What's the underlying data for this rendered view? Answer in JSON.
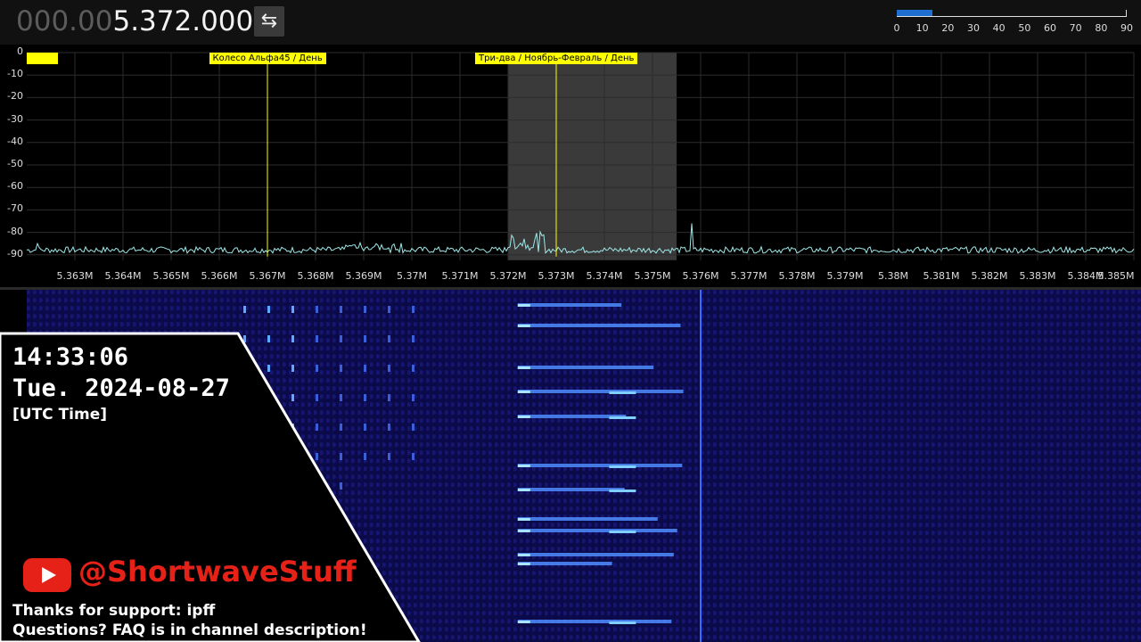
{
  "header": {
    "frequency_dim": "000.00",
    "frequency_bright": "5.372.000",
    "swap_icon": "swap-arrows-icon",
    "swap_glyph": "⇆",
    "meter": {
      "value": 14,
      "max": 90,
      "fill_color": "#1e6fd0",
      "labels": [
        "0",
        "10",
        "20",
        "30",
        "40",
        "50",
        "60",
        "70",
        "80",
        "90"
      ]
    }
  },
  "spectrum": {
    "db_labels": [
      "0",
      "-10",
      "-20",
      "-30",
      "-40",
      "-50",
      "-60",
      "-70",
      "-80",
      "-90"
    ],
    "freq_labels": [
      "5.363M",
      "5.364M",
      "5.365M",
      "5.366M",
      "5.367M",
      "5.368M",
      "5.369M",
      "5.37M",
      "5.371M",
      "5.372M",
      "5.373M",
      "5.374M",
      "5.375M",
      "5.376M",
      "5.377M",
      "5.378M",
      "5.379M",
      "5.38M",
      "5.381M",
      "5.382M",
      "5.383M",
      "5.384M",
      "5.385M"
    ],
    "markers": [
      {
        "label": "Колесо Альфа45 / День",
        "freq": 5.367
      },
      {
        "label": "Три-два / Ноябрь-Февраль / День",
        "freq": 5.373
      }
    ],
    "passband": {
      "start_mhz": 5.372,
      "end_mhz": 5.3755
    },
    "trace_color": "#9fe8e8",
    "marker_color": "#ffff00",
    "band_edge_color": "#e03030"
  },
  "overlay": {
    "time": "14:33:06",
    "date": "Tue. 2024-08-27",
    "timezone": "[UTC Time]",
    "channel_icon": "youtube-icon",
    "channel_handle": "@ShortwaveStuff",
    "support": "Thanks for support: ipff",
    "faq": "Questions? FAQ is in channel description!"
  }
}
